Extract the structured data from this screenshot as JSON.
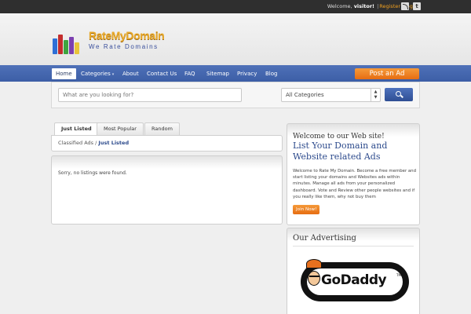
{
  "topbar": {
    "welcome_prefix": "Welcome, ",
    "visitor": "visitor!",
    "register": "Register",
    "login": "Login",
    "separator": "|",
    "rss_icon": "rss-icon",
    "twitter_icon": "twitter-icon",
    "twitter_glyph": "t"
  },
  "brand": {
    "name": "RateMyDomain",
    "tagline": "We Rate Domains",
    "name_color": "#e8a92a",
    "tagline_color": "#3a4f9c"
  },
  "nav": {
    "items": [
      {
        "label": "Home",
        "active": true
      },
      {
        "label": "Categories",
        "dropdown": true
      },
      {
        "label": "About"
      },
      {
        "label": "Contact Us"
      },
      {
        "label": "FAQ"
      },
      {
        "label": "Sitemap"
      },
      {
        "label": "Privacy"
      },
      {
        "label": "Blog"
      }
    ],
    "caret_glyph": "▾",
    "post_ad": "Post an Ad",
    "bar_color": "#3c5ea6",
    "accent_color": "#e66d12"
  },
  "search": {
    "placeholder": "What are you looking for?",
    "category_selected": "All Categories",
    "arrow_up": "▲",
    "arrow_down": "▼",
    "button_icon": "search-icon"
  },
  "tabs": [
    {
      "label": "Just Listed",
      "active": true
    },
    {
      "label": "Most Popular"
    },
    {
      "label": "Random"
    }
  ],
  "breadcrumb": {
    "root": "Classified Ads",
    "separator": "/",
    "current": "Just Listed"
  },
  "listings": {
    "empty_message": "Sorry, no listings were found."
  },
  "welcome_widget": {
    "heading": "Welcome to our Web site!",
    "title": "List Your Domain and Website related Ads",
    "body": "Welcome to Rate My Domain. Become a free member and start listing your domains and Websites ads within minutes. Manage all ads from your personalized dashboard. Vote and Review other people websites and if you really like them, why not buy them",
    "join_button": "Join Now!"
  },
  "advertising_widget": {
    "heading": "Our Advertising",
    "ad_logo_text": "GoDaddy",
    "ad_trademark": "TM"
  }
}
